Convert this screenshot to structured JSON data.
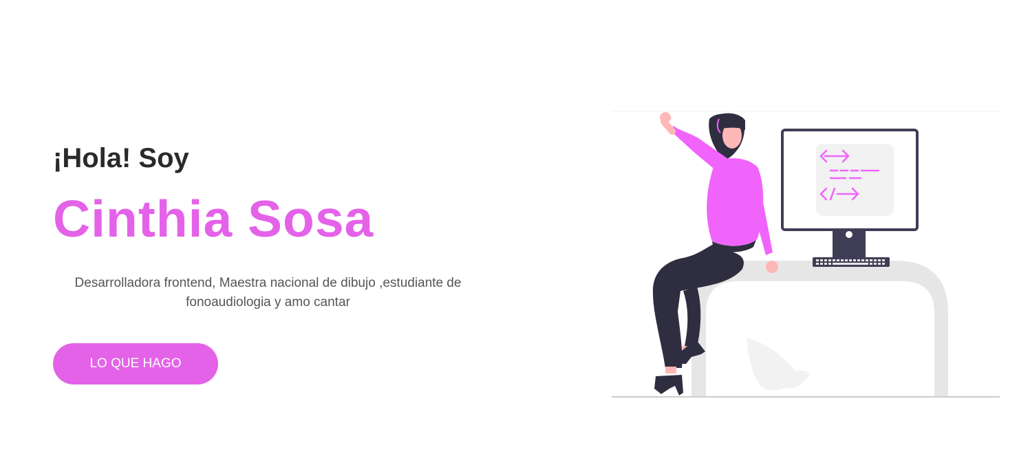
{
  "hero": {
    "greeting": "¡Hola! Soy",
    "name": "Cinthia Sosa",
    "description": "Desarrolladora frontend, Maestra nacional de dibujo ,estudiante de fonoaudiologia y amo cantar",
    "cta_label": "LO QUE HAGO"
  },
  "colors": {
    "accent": "#e462e8",
    "heading": "#2a2a2a",
    "text": "#555555",
    "figure_shirt": "#f064fc",
    "figure_dark": "#2f2e41",
    "skin": "#ffb8b8",
    "desk": "#e6e6e6"
  },
  "illustration": {
    "icons": [
      "woman-figure-icon",
      "monitor-icon",
      "code-tag-icon",
      "keyboard-icon",
      "plant-leaf-icon",
      "desk-icon"
    ]
  }
}
